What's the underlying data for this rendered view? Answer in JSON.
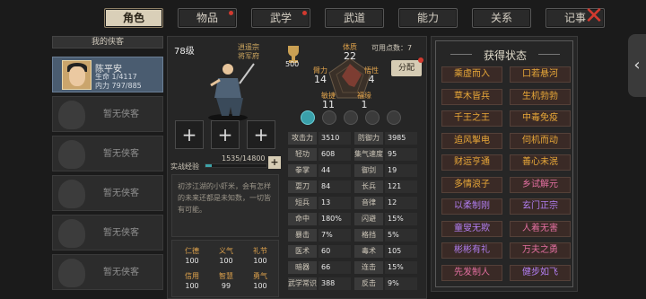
{
  "tabs": [
    {
      "label": "角色",
      "active": true,
      "badge": false
    },
    {
      "label": "物品",
      "active": false,
      "badge": true
    },
    {
      "label": "武学",
      "active": false,
      "badge": true
    },
    {
      "label": "武道",
      "active": false,
      "badge": false
    },
    {
      "label": "能力",
      "active": false,
      "badge": false
    },
    {
      "label": "关系",
      "active": false,
      "badge": false
    },
    {
      "label": "记事",
      "active": false,
      "badge": false
    }
  ],
  "close_icon": "close-x-icon",
  "roster": {
    "title": "我的侠客",
    "selected": {
      "name": "陈平安",
      "hp": "生命 1/4117",
      "mp": "内力 797/885"
    },
    "empty_label": "暂无侠客",
    "empty_count": 6
  },
  "character": {
    "level": "78级",
    "sect_line1": "逍遥宗",
    "sect_line2": "将军府",
    "potential": "500",
    "points": "可用点数：7",
    "allocate_label": "分配",
    "attributes": {
      "constitution": {
        "label": "体质",
        "value": "22"
      },
      "arm": {
        "label": "臂力",
        "value": "14"
      },
      "comprehension": {
        "label": "悟性",
        "value": "4"
      },
      "agility": {
        "label": "敏捷",
        "value": "11"
      },
      "fortune": {
        "label": "福缘",
        "value": "1"
      }
    },
    "exp_label": "实战经验",
    "exp_text": "1535/14800",
    "exp_fraction": 0.104,
    "description": "初涉江湖的小虾米，会有怎样的未来还都是未知数，一切皆有可能。",
    "virtues": [
      {
        "label": "仁德",
        "value": "100"
      },
      {
        "label": "义气",
        "value": "100"
      },
      {
        "label": "礼节",
        "value": "100"
      },
      {
        "label": "信用",
        "value": "100"
      },
      {
        "label": "智慧",
        "value": "99"
      },
      {
        "label": "勇气",
        "value": "100"
      }
    ],
    "stats_left": [
      {
        "label": "攻击力",
        "value": "3510"
      },
      {
        "label": "轻功",
        "value": "608"
      },
      {
        "label": "拳掌",
        "value": "44"
      },
      {
        "label": "耍刀",
        "value": "84"
      },
      {
        "label": "短兵",
        "value": "13"
      },
      {
        "label": "命中",
        "value": "180%"
      },
      {
        "label": "暴击",
        "value": "7%"
      },
      {
        "label": "医术",
        "value": "60"
      },
      {
        "label": "暗器",
        "value": "66"
      },
      {
        "label": "武学常识",
        "value": "388"
      }
    ],
    "stats_right": [
      {
        "label": "防御力",
        "value": "3985"
      },
      {
        "label": "集气速度",
        "value": "95"
      },
      {
        "label": "御剑",
        "value": "19"
      },
      {
        "label": "长兵",
        "value": "121"
      },
      {
        "label": "音律",
        "value": "12"
      },
      {
        "label": "闪避",
        "value": "15%"
      },
      {
        "label": "格挡",
        "value": "5%"
      },
      {
        "label": "毒术",
        "value": "105"
      },
      {
        "label": "连击",
        "value": "15%"
      },
      {
        "label": "反击",
        "value": "9%"
      }
    ]
  },
  "status": {
    "title": "获得状态",
    "tags": [
      {
        "label": "乘虚而入",
        "color": "gold"
      },
      {
        "label": "口若悬河",
        "color": "gold"
      },
      {
        "label": "草木皆兵",
        "color": "gold"
      },
      {
        "label": "生机勃勃",
        "color": "gold"
      },
      {
        "label": "千王之王",
        "color": "gold"
      },
      {
        "label": "中毒免疫",
        "color": "gold"
      },
      {
        "label": "追风掣电",
        "color": "gold"
      },
      {
        "label": "伺机而动",
        "color": "gold"
      },
      {
        "label": "财运亨通",
        "color": "gold"
      },
      {
        "label": "善心未泯",
        "color": "gold"
      },
      {
        "label": "多情浪子",
        "color": "gold"
      },
      {
        "label": "乡试解元",
        "color": "pink"
      },
      {
        "label": "以柔制刚",
        "color": "purple"
      },
      {
        "label": "玄门正宗",
        "color": "purple"
      },
      {
        "label": "童叟无欺",
        "color": "purple"
      },
      {
        "label": "人着无害",
        "color": "pink"
      },
      {
        "label": "彬彬有礼",
        "color": "purple"
      },
      {
        "label": "万夫之勇",
        "color": "pink"
      },
      {
        "label": "先发制人",
        "color": "pink"
      },
      {
        "label": "健步如飞",
        "color": "purple"
      }
    ]
  }
}
